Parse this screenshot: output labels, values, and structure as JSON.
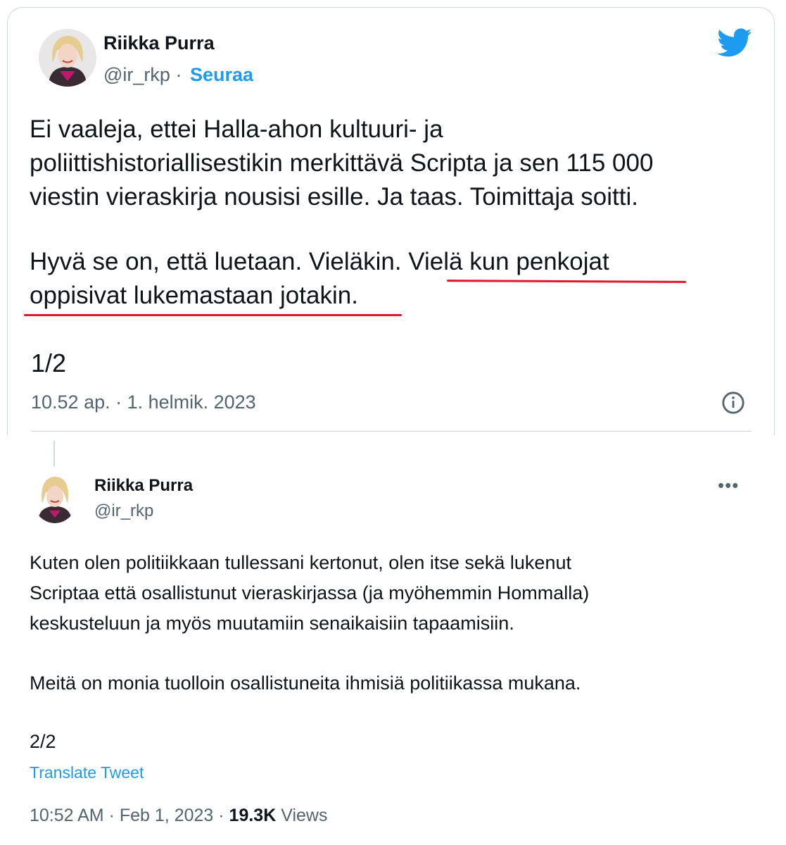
{
  "tweet1": {
    "author_name": "Riikka Purra",
    "handle": "@ir_rkp",
    "separator": "·",
    "follow_label": "Seuraa",
    "logo_icon": "twitter-bird-icon",
    "body_paragraph1": "Ei vaaleja, ettei Halla-ahon kultuuri- ja\npoliittishistoriallisestikin merkittävä Scripta ja sen 115 000\nviestin vieraskirja nousisi esille. Ja taas. Toimittaja soitti.",
    "body_paragraph2_plain": "Hyvä se on, että luetaan. Vieläkin. ",
    "body_paragraph2_underlined": "Vielä kun penkojat\noppisivat lukemastaan jotakin.",
    "underline_color": "#e0162b",
    "thread_count": "1/2",
    "timestamp": "10.52 ap. · 1. helmik. 2023",
    "info_icon": "info-icon"
  },
  "tweet2": {
    "author_name": "Riikka Purra",
    "handle": "@ir_rkp",
    "more_label": "•••",
    "body_paragraph1": "Kuten olen politiikkaan tullessani kertonut, olen itse sekä lukenut\nScriptaa että osallistunut vieraskirjassa (ja myöhemmin Hommalla)\nkeskusteluun ja myös muutamiin senaikaisiin tapaamisiin.",
    "body_paragraph2": "Meitä on monia tuolloin osallistuneita ihmisiä politiikassa mukana.",
    "thread_count": "2/2",
    "translate_label": "Translate Tweet",
    "time": "10:52 AM",
    "date": "Feb 1, 2023",
    "views_count": "19.3K",
    "views_label": "Views"
  },
  "colors": {
    "text": "#0f1419",
    "secondary": "#536471",
    "accent": "#1d9bf0",
    "border": "#cfd9de",
    "highlight_underline": "#e0162b"
  }
}
